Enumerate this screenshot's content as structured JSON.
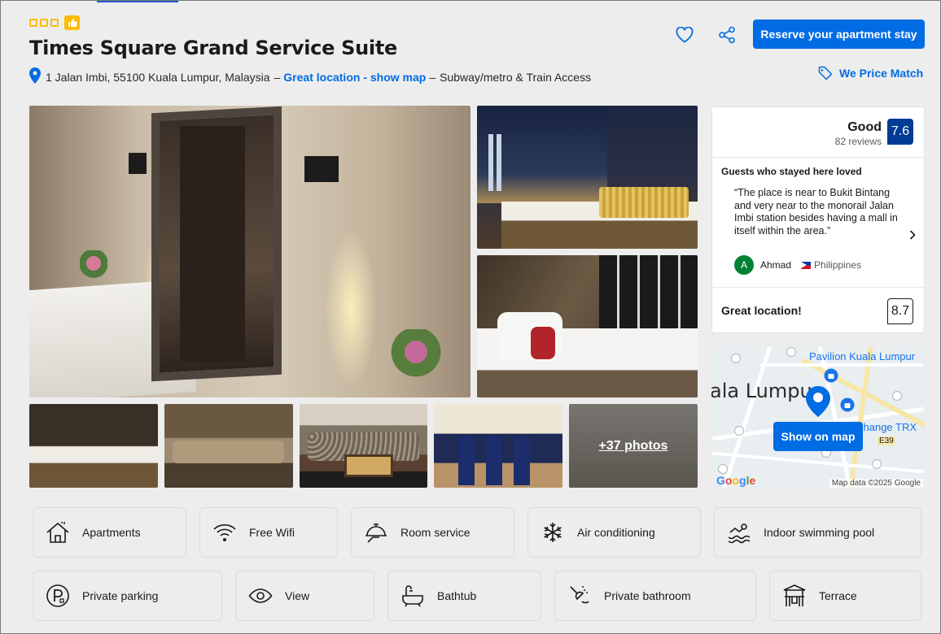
{
  "header": {
    "title": "Times Square Grand Service Suite",
    "address": "1 Jalan Imbi, 55100 Kuala Lumpur, Malaysia",
    "dash1": "–",
    "location_link": "Great location - show map",
    "dash2": "–",
    "transit": "Subway/metro & Train Access",
    "reserve_label": "Reserve your apartment stay",
    "price_match": "We Price Match"
  },
  "colors": {
    "brand_blue": "#006ce4",
    "score_blue": "#003b95",
    "star_yellow": "#febb02"
  },
  "gallery": {
    "more_photos": "+37 photos"
  },
  "review": {
    "rating_word": "Good",
    "review_count": "82 reviews",
    "score": "7.6",
    "loved_heading": "Guests who stayed here loved",
    "quote": "“The place is near to Bukit Bintang and very near to the monorail Jalan Imbi station besides having a mall in itself within the area.”",
    "avatar_initial": "A",
    "reviewer": "Ahmad",
    "country": "Philippines",
    "location_label": "Great location!",
    "location_score": "8.7"
  },
  "map": {
    "city_label": "ala Lumpu",
    "pavilion_label": "Pavilion Kuala Lumpur",
    "trx_label": "change TRX",
    "road_label": "E39",
    "show_on_map": "Show on map",
    "google": "Google",
    "map_data": "Map data ©2025 Google"
  },
  "facilities": [
    {
      "label": "Apartments",
      "icon": "house-icon"
    },
    {
      "label": "Free Wifi",
      "icon": "wifi-icon"
    },
    {
      "label": "Room service",
      "icon": "room-service-icon"
    },
    {
      "label": "Air conditioning",
      "icon": "snowflake-icon"
    },
    {
      "label": "Indoor swimming pool",
      "icon": "swimmer-icon"
    },
    {
      "label": "Private parking",
      "icon": "parking-icon"
    },
    {
      "label": "View",
      "icon": "eye-icon"
    },
    {
      "label": "Bathtub",
      "icon": "bathtub-icon"
    },
    {
      "label": "Private bathroom",
      "icon": "shower-icon"
    },
    {
      "label": "Terrace",
      "icon": "terrace-icon"
    }
  ]
}
